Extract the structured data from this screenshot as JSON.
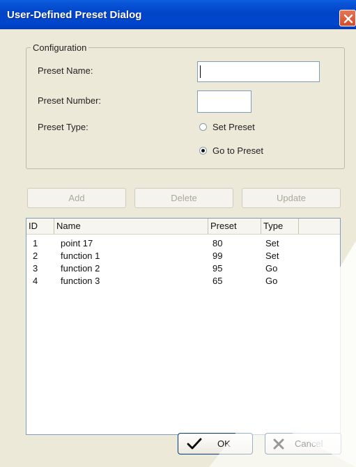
{
  "window": {
    "title": "User-Defined Preset Dialog"
  },
  "configuration": {
    "legend": "Configuration",
    "preset_name_label": "Preset Name:",
    "preset_name_value": "",
    "preset_number_label": "Preset Number:",
    "preset_number_value": "",
    "preset_type_label": "Preset Type:",
    "options": [
      {
        "label": "Set Preset",
        "checked": false
      },
      {
        "label": "Go to Preset",
        "checked": true
      }
    ]
  },
  "actions": {
    "add": "Add",
    "delete": "Delete",
    "update": "Update"
  },
  "table": {
    "columns": [
      "ID",
      "Name",
      "Preset",
      "Type"
    ],
    "rows": [
      [
        "1",
        "point 17",
        "80",
        "Set"
      ],
      [
        "2",
        "function 1",
        "99",
        "Set"
      ],
      [
        "3",
        "function 2",
        "95",
        "Go"
      ],
      [
        "4",
        "function 3",
        "65",
        "Go"
      ]
    ]
  },
  "footer": {
    "ok": "OK",
    "cancel": "Cancel"
  },
  "icons": {
    "close": "close-icon",
    "ok": "checkmark-icon",
    "cancel": "x-icon"
  }
}
